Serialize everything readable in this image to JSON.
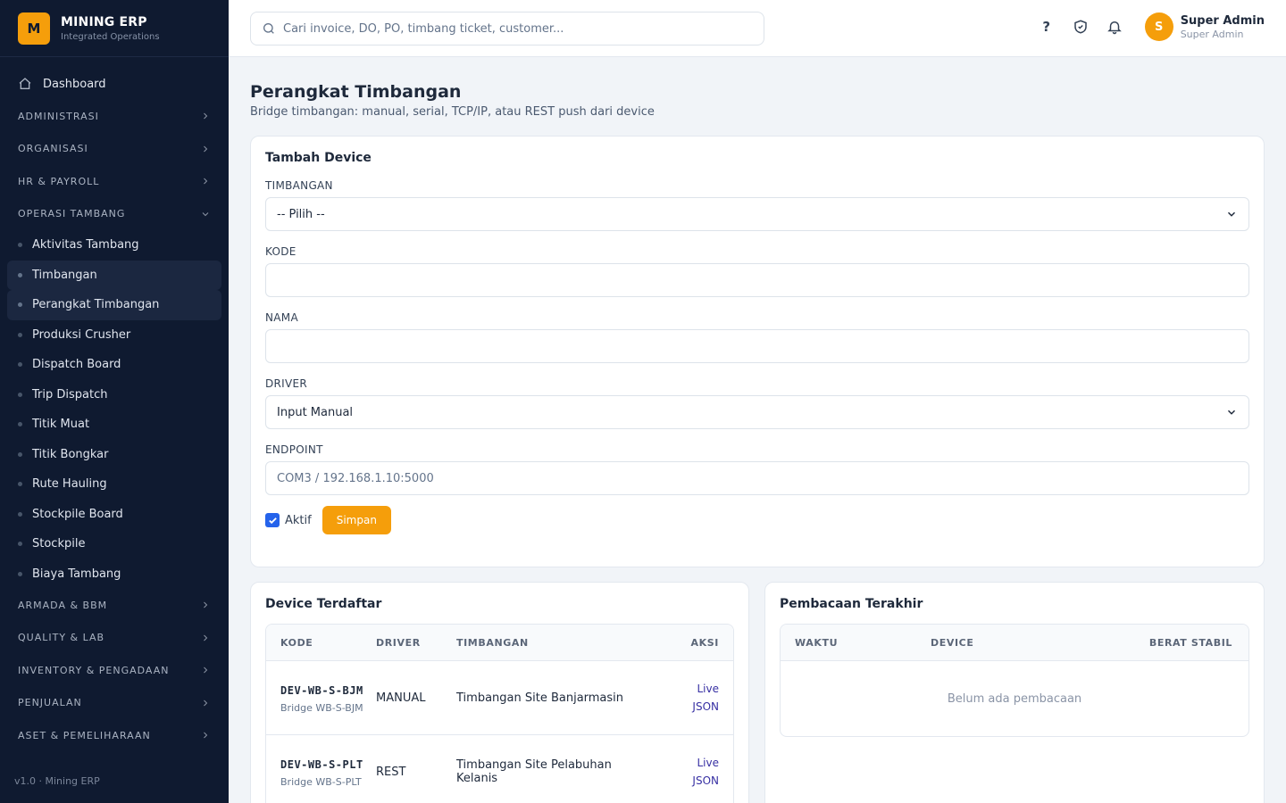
{
  "brand": {
    "logo_letter": "M",
    "name": "MINING ERP",
    "subtitle": "Integrated Operations"
  },
  "sidebar": {
    "dashboard": "Dashboard",
    "groups_top": [
      "ADMINISTRASI",
      "ORGANISASI",
      "HR & PAYROLL"
    ],
    "open_group": "OPERASI TAMBANG",
    "sub_items": [
      "Aktivitas Tambang",
      "Timbangan",
      "Perangkat Timbangan",
      "Produksi Crusher",
      "Dispatch Board",
      "Trip Dispatch",
      "Titik Muat",
      "Titik Bongkar",
      "Rute Hauling",
      "Stockpile Board",
      "Stockpile",
      "Biaya Tambang"
    ],
    "groups_bottom": [
      "ARMADA & BBM",
      "QUALITY & LAB",
      "INVENTORY & PENGADAAN",
      "PENJUALAN",
      "ASET & PEMELIHARAAN"
    ],
    "footer": "v1.0 · Mining ERP"
  },
  "search": {
    "placeholder": "Cari invoice, DO, PO, timbang ticket, customer..."
  },
  "user": {
    "initial": "S",
    "name": "Super Admin",
    "role": "Super Admin"
  },
  "page": {
    "title": "Perangkat Timbangan",
    "subtitle": "Bridge timbangan: manual, serial, TCP/IP, atau REST push dari device"
  },
  "form": {
    "title": "Tambah Device",
    "timbangan_label": "TIMBANGAN",
    "timbangan_value": "-- Pilih --",
    "kode_label": "KODE",
    "kode_value": "",
    "nama_label": "NAMA",
    "nama_value": "",
    "driver_label": "DRIVER",
    "driver_value": "Input Manual",
    "endpoint_label": "ENDPOINT",
    "endpoint_placeholder": "COM3 / 192.168.1.10:5000",
    "aktif_label": "Aktif",
    "save_label": "Simpan"
  },
  "devices": {
    "title": "Device Terdaftar",
    "headers": [
      "KODE",
      "DRIVER",
      "TIMBANGAN",
      "AKSI"
    ],
    "rows": [
      {
        "kode": "DEV-WB-S-BJM",
        "nama": "Bridge WB-S-BJM",
        "driver": "MANUAL",
        "timbangan": "Timbangan Site Banjarmasin",
        "live": "Live",
        "json": "JSON"
      },
      {
        "kode": "DEV-WB-S-PLT",
        "nama": "Bridge WB-S-PLT",
        "driver": "REST",
        "timbangan": "Timbangan Site Pelabuhan Kelanis",
        "live": "Live",
        "json": "JSON"
      }
    ]
  },
  "readings": {
    "title": "Pembacaan Terakhir",
    "headers": [
      "WAKTU",
      "DEVICE",
      "BERAT STABIL"
    ],
    "empty": "Belum ada pembacaan"
  }
}
